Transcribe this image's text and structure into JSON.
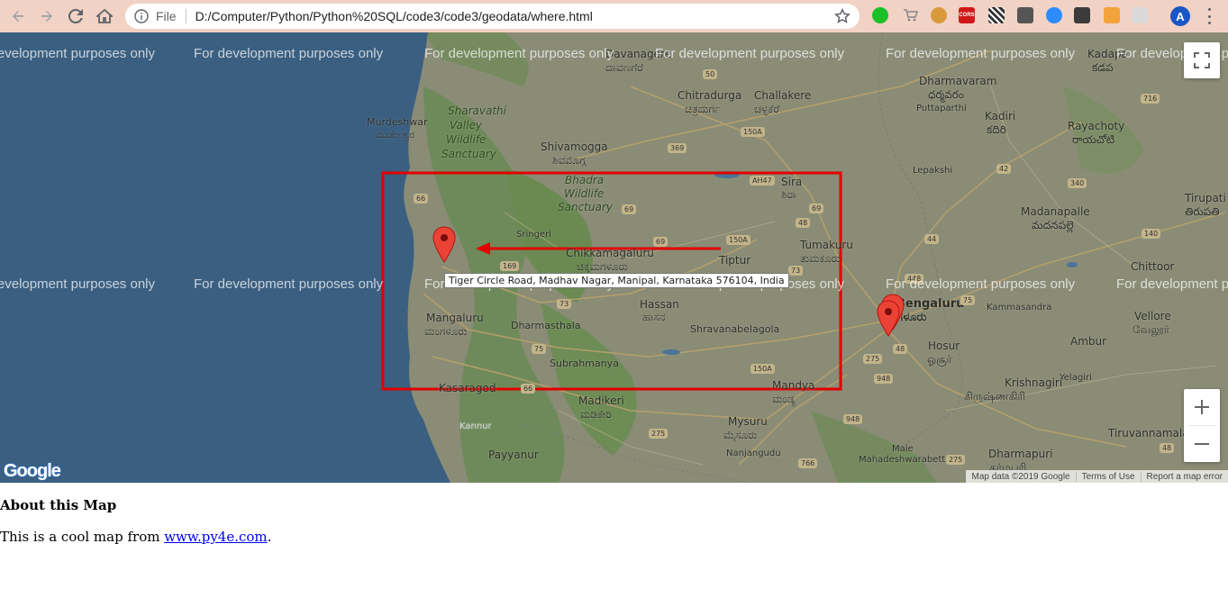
{
  "browser": {
    "file_label": "File",
    "url": "D:/Computer/Python/Python%20SQL/code3/code3/geodata/where.html",
    "profile_initial": "A",
    "extensions": [
      "ext-green-icon",
      "ext-cart-icon",
      "ext-cookie-icon",
      "ext-cors-icon",
      "ext-qr-icon",
      "ext-reader-icon",
      "ext-zoom-icon",
      "ext-tab-icon",
      "ext-orange-icon",
      "ext-pdf-icon"
    ],
    "cors_label": "CORS"
  },
  "map": {
    "watermark": "For development purposes only",
    "tooltip": "Tiger Circle Road, Madhav Nagar, Manipal, Karnataka 576104, India",
    "attribution": {
      "data": "Map data ©2019 Google",
      "terms": "Terms of Use",
      "report": "Report a map error"
    },
    "google_logo": "Google",
    "highlight_color": "#e00000",
    "marker_color": "#ea4335",
    "labels": [
      {
        "text": "Kadapa",
        "cls": ""
      },
      {
        "text": "కడప",
        "cls": ""
      },
      {
        "text": "Davanagere",
        "cls": ""
      },
      {
        "text": "ದಾವಣಗೆರೆ",
        "cls": ""
      },
      {
        "text": "Chitradurga",
        "cls": ""
      },
      {
        "text": "ಚಿತ್ರದುರ್ಗ",
        "cls": ""
      },
      {
        "text": "Challakere",
        "cls": ""
      },
      {
        "text": "ಚಳ್ಳಕೆರೆ",
        "cls": ""
      },
      {
        "text": "Dharmavaram",
        "cls": ""
      },
      {
        "text": "ధర్మవరం",
        "cls": ""
      },
      {
        "text": "Puttaparthi",
        "cls": ""
      },
      {
        "text": "Kadiri",
        "cls": ""
      },
      {
        "text": "కదిరి",
        "cls": ""
      },
      {
        "text": "Rayachoty",
        "cls": ""
      },
      {
        "text": "రాయచోటి",
        "cls": ""
      },
      {
        "text": "Murdeshwar",
        "cls": ""
      },
      {
        "text": "ಮುರ್ಡೇಶ್ವರ",
        "cls": ""
      },
      {
        "text": "Sharavathi",
        "cls": "green"
      },
      {
        "text": "Valley",
        "cls": "green"
      },
      {
        "text": "Wildlife",
        "cls": "green"
      },
      {
        "text": "Sanctuary",
        "cls": "green"
      },
      {
        "text": "Shivamogga",
        "cls": ""
      },
      {
        "text": "ಶಿವಮೊಗ್ಗ",
        "cls": ""
      },
      {
        "text": "Bhadra",
        "cls": "green"
      },
      {
        "text": "Wildlife",
        "cls": "green"
      },
      {
        "text": "Sanctuary",
        "cls": "green"
      },
      {
        "text": "Sira",
        "cls": ""
      },
      {
        "text": "ಶಿರಾ",
        "cls": ""
      },
      {
        "text": "Lepakshi",
        "cls": ""
      },
      {
        "text": "Madanapalle",
        "cls": ""
      },
      {
        "text": "మదనపల్లె",
        "cls": ""
      },
      {
        "text": "Tirupati",
        "cls": ""
      },
      {
        "text": "తిరుపతి",
        "cls": ""
      },
      {
        "text": "Sringeri",
        "cls": ""
      },
      {
        "text": "Chikkamagaluru",
        "cls": ""
      },
      {
        "text": "ಚಿಕ್ಕಮಗಳೂರು",
        "cls": ""
      },
      {
        "text": "Tumakuru",
        "cls": ""
      },
      {
        "text": "ತುಮಕೂರು",
        "cls": ""
      },
      {
        "text": "Tiptur",
        "cls": ""
      },
      {
        "text": "Bengaluru",
        "cls": "big"
      },
      {
        "text": "ಬೆಂಗಳೂರು",
        "cls": "big"
      },
      {
        "text": "Chittoor",
        "cls": ""
      },
      {
        "text": "Kammasandra",
        "cls": ""
      },
      {
        "text": "Vellore",
        "cls": ""
      },
      {
        "text": "வேலூர்",
        "cls": ""
      },
      {
        "text": "Mangaluru",
        "cls": ""
      },
      {
        "text": "ಮಂಗಳೂರು",
        "cls": ""
      },
      {
        "text": "Dharmasthala",
        "cls": ""
      },
      {
        "text": "Hassan",
        "cls": ""
      },
      {
        "text": "ಹಾಸನ",
        "cls": ""
      },
      {
        "text": "Shravanabelagola",
        "cls": ""
      },
      {
        "text": "Hosur",
        "cls": ""
      },
      {
        "text": "ஓசூர்",
        "cls": ""
      },
      {
        "text": "Ambur",
        "cls": ""
      },
      {
        "text": "Subrahmanya",
        "cls": ""
      },
      {
        "text": "Kasaragod",
        "cls": ""
      },
      {
        "text": "Madikeri",
        "cls": ""
      },
      {
        "text": "ಮಡಿಕೇರಿ",
        "cls": ""
      },
      {
        "text": "Mandya",
        "cls": ""
      },
      {
        "text": "ಮಂಡ್ಯ",
        "cls": ""
      },
      {
        "text": "Krishnagiri",
        "cls": ""
      },
      {
        "text": "கிருஷ்ணகிரி",
        "cls": ""
      },
      {
        "text": "Yelagiri",
        "cls": ""
      },
      {
        "text": "Mysuru",
        "cls": ""
      },
      {
        "text": "ಮೈಸೂರು",
        "cls": ""
      },
      {
        "text": "Tiruvannamalai",
        "cls": ""
      },
      {
        "text": "Payyanur",
        "cls": ""
      },
      {
        "text": "Nanjangudu",
        "cls": ""
      },
      {
        "text": "Male",
        "cls": ""
      },
      {
        "text": "Mahadeshwarabetta",
        "cls": ""
      },
      {
        "text": "Dharmapuri",
        "cls": ""
      },
      {
        "text": "தர்மபுரி",
        "cls": ""
      },
      {
        "text": "Kannur",
        "cls": ""
      }
    ],
    "shields": [
      "50",
      "150A",
      "369",
      "AH47",
      "42",
      "340",
      "716",
      "66",
      "69",
      "48",
      "69",
      "150A",
      "69",
      "44",
      "140",
      "169",
      "73",
      "73",
      "75",
      "448",
      "75",
      "150A",
      "275",
      "48",
      "948",
      "275",
      "766",
      "948",
      "48",
      "66",
      "275"
    ]
  },
  "page": {
    "heading": "About this Map",
    "text_before": "This is a cool map from ",
    "link": "www.py4e.com",
    "text_after": "."
  }
}
